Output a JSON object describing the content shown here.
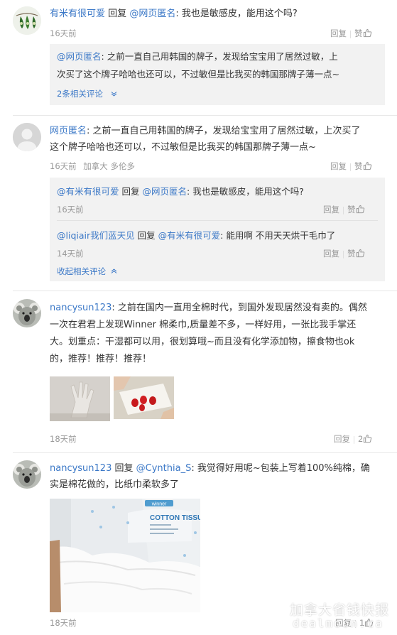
{
  "comments": [
    {
      "user": "有米有很可爱",
      "reply_word": "回复",
      "reply_to": "@网页匿名",
      "text": ": 我也是敏感皮，能用这个吗?",
      "time": "16天前",
      "reply_label": "回复",
      "like_label": "赞",
      "quote": {
        "user": "@网页匿名",
        "line1": ": 之前一直自己用韩国的牌子，发现给宝宝用了居然过敏，上",
        "line2": "次买了这个牌子哈哈也还可以，不过敏但是比我买的韩国那牌子薄一点~",
        "related": "2条相关评论"
      }
    },
    {
      "user": "网页匿名",
      "line1": ": 之前一直自己用韩国的牌子，发现给宝宝用了居然过敏，上次买了",
      "line2": "这个牌子哈哈也还可以，不过敏但是比我买的韩国那牌子薄一点~",
      "time": "16天前",
      "location": "加拿大 多伦多",
      "reply_label": "回复",
      "like_label": "赞",
      "subreplies": [
        {
          "user": "@有米有很可爱",
          "reply_word": "回复",
          "reply_to": "@网页匿名",
          "text": ": 我也是敏感皮，能用这个吗?",
          "time": "16天前"
        },
        {
          "user": "@liqiair我们蓝天见",
          "reply_word": "回复",
          "reply_to": "@有米有很可爱",
          "text": ": 能用啊 不用天天烘干毛巾了",
          "time": "14天前"
        }
      ],
      "collapse": "收起相关评论"
    },
    {
      "user": "nancysun123",
      "line1": ": 之前在国内一直用全棉时代，到国外发现居然没有卖的。偶然",
      "line2": "一次在君君上发现Winner 棉柔巾,质量差不多，一样好用，一张比我手掌还",
      "line3": "大。划重点：干湿都可以用，很划算哦~而且没有化学添加物，擦食物也ok",
      "line4": "的，推荐！推荐！推荐！",
      "time": "18天前",
      "reply_label": "回复",
      "like_count": "2"
    },
    {
      "user": "nancysun123",
      "reply_word": "回复",
      "reply_to": "@Cynthia_S",
      "line1": ": 我觉得好用呢~包装上写着100%纯棉，确",
      "line2": "实是棉花做的，比纸巾柔软多了",
      "time": "18天前",
      "reply_label": "回复",
      "like_count": "1",
      "package": {
        "brand": "winner",
        "product": "COTTON TISSUE"
      }
    }
  ],
  "watermark": {
    "cn": "加拿大省钱快报",
    "en": "dealmoon.ca"
  },
  "colors": {
    "link": "#3b78c7",
    "meta": "#999999",
    "quote_bg": "#f2f2f2"
  }
}
